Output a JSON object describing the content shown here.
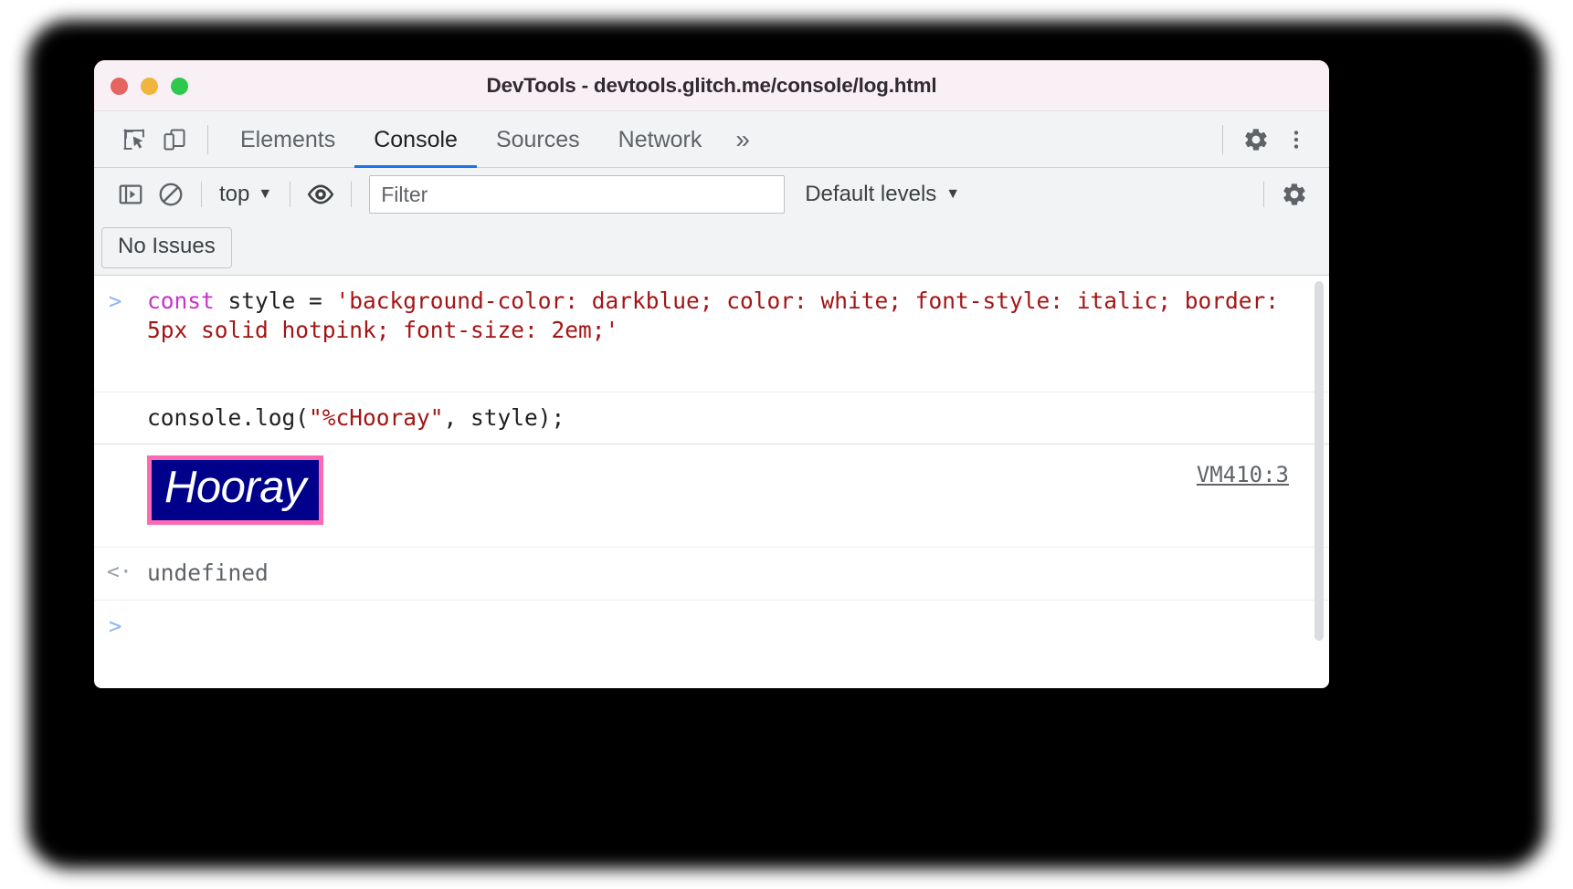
{
  "window": {
    "title": "DevTools - devtools.glitch.me/console/log.html",
    "traffic_lights": [
      "close-red",
      "minimize-yellow",
      "maximize-green"
    ]
  },
  "tabbar": {
    "inspect_icon": "inspect-element-icon",
    "device_icon": "device-toolbar-icon",
    "tabs": [
      {
        "label": "Elements",
        "active": false
      },
      {
        "label": "Console",
        "active": true
      },
      {
        "label": "Sources",
        "active": false
      },
      {
        "label": "Network",
        "active": false
      }
    ],
    "more_tabs": "»",
    "settings_icon": "gear-icon",
    "menu_icon": "more-vertical-icon"
  },
  "console_toolbar": {
    "sidebar_toggle_icon": "console-sidebar-icon",
    "clear_console_icon": "clear-console-icon",
    "context_label": "top",
    "context_caret": "▼",
    "live_expression_icon": "eye-icon",
    "filter_placeholder": "Filter",
    "filter_value": "",
    "levels_label": "Default levels",
    "levels_caret": "▼",
    "settings_icon": "console-settings-gear-icon"
  },
  "issues": {
    "button_label": "No Issues"
  },
  "console": {
    "prompt_symbol": ">",
    "return_symbol": "<·",
    "entries": [
      {
        "type": "input",
        "segments": [
          {
            "text": "const ",
            "style": "keyword"
          },
          {
            "text": "style = ",
            "style": "plain"
          },
          {
            "text": "'background-color: darkblue; color: white; font-style: italic; border: 5px solid hotpink; font-size: 2em;'",
            "style": "string"
          }
        ]
      },
      {
        "type": "input",
        "segments": [
          {
            "text": "console.log(",
            "style": "plain"
          },
          {
            "text": "\"%cHooray\"",
            "style": "string"
          },
          {
            "text": ", style);",
            "style": "plain"
          }
        ]
      },
      {
        "type": "styled-output",
        "text": "Hooray",
        "source_link": "VM410:3",
        "applied_style": {
          "background-color": "darkblue",
          "color": "white",
          "font-style": "italic",
          "border": "5px solid hotpink",
          "font-size": "2em"
        }
      },
      {
        "type": "result",
        "text": "undefined"
      }
    ]
  },
  "colors": {
    "accent_blue": "#1a73e8",
    "prompt_blue": "#8ab4f8",
    "keyword_magenta": "#c932c9",
    "string_red": "#a31515",
    "hotpink": "#ff69b4",
    "darkblue": "#00008b",
    "titlebar_bg": "#f8f0f5",
    "toolbar_bg": "#f1f3f4"
  }
}
